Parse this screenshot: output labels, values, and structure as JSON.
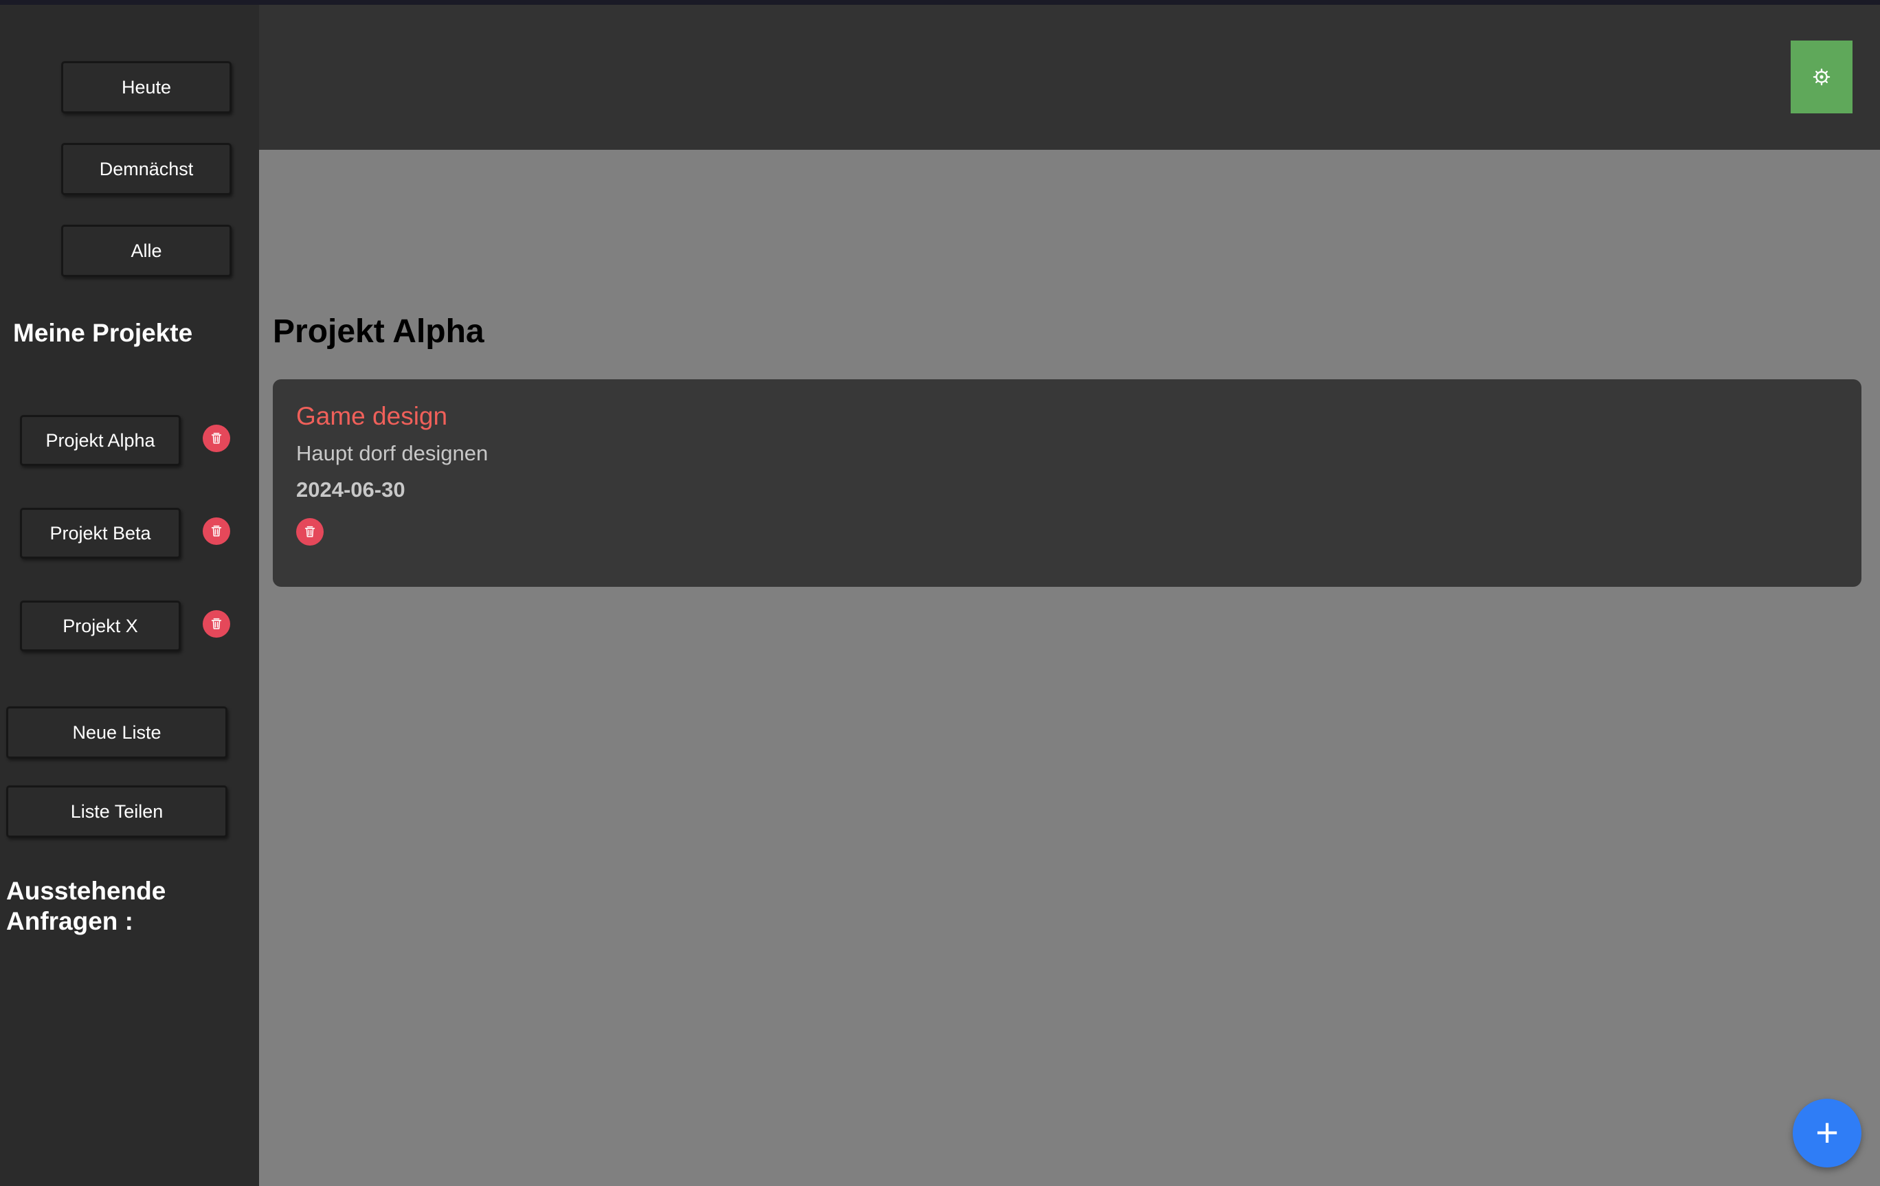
{
  "sidebar": {
    "nav": [
      {
        "label": "Heute"
      },
      {
        "label": "Demnächst"
      },
      {
        "label": "Alle"
      }
    ],
    "projects_title": "Meine Projekte",
    "projects": [
      {
        "label": "Projekt Alpha",
        "delete_icon": "trash-icon"
      },
      {
        "label": "Projekt Beta",
        "delete_icon": "trash-icon"
      },
      {
        "label": "Projekt X",
        "delete_icon": "trash-icon"
      }
    ],
    "actions": {
      "new_list": "Neue Liste",
      "share_list": "Liste Teilen"
    },
    "pending_title_line1": "Ausstehende",
    "pending_title_line2": "Anfragen :"
  },
  "header": {
    "settings_icon": "gear-icon",
    "settings_color": "#5fa85a"
  },
  "main": {
    "title": "Projekt Alpha",
    "tasks": [
      {
        "title": "Game design",
        "description": "Haupt dorf designen",
        "date": "2024-06-30",
        "delete_icon": "trash-icon"
      }
    ]
  },
  "fab": {
    "label": "+",
    "icon": "plus-icon",
    "color": "#2f7df6"
  },
  "colors": {
    "sidebar_bg": "#2b2b2b",
    "header_bg": "#333333",
    "main_bg": "#808080",
    "card_bg": "#383838",
    "task_title": "#f0605a",
    "delete": "#e5485a"
  }
}
